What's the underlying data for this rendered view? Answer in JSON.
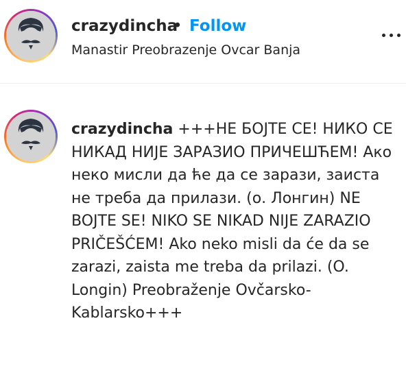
{
  "post": {
    "username": "crazydincha",
    "separator": "•",
    "follow_label": "Follow",
    "location": "Manastir Preobrazenje Ovcar Banja",
    "more_icon": "more-horizontal-icon"
  },
  "comment": {
    "username": "crazydincha",
    "text": "+++НЕ БОЈТЕ СЕ! НИКО СЕ НИКАД НИЈЕ ЗАРАЗИО ПРИЧЕШЋЕМ! Ако неко мисли да ће да се зарази, заиста не треба да прилази. (о. Лонгин) NE BOJTE SE! NIKO SE NIKAD NIJE ZARAZIO PRIČEŠĆEM! Ako neko misli da će da se zarazi, zaista me treba da prilazi. (O. Longin) Preobraženje Ovčarsko-Kablarsko+++"
  },
  "colors": {
    "link_blue": "#0095f6",
    "text": "#262626"
  }
}
